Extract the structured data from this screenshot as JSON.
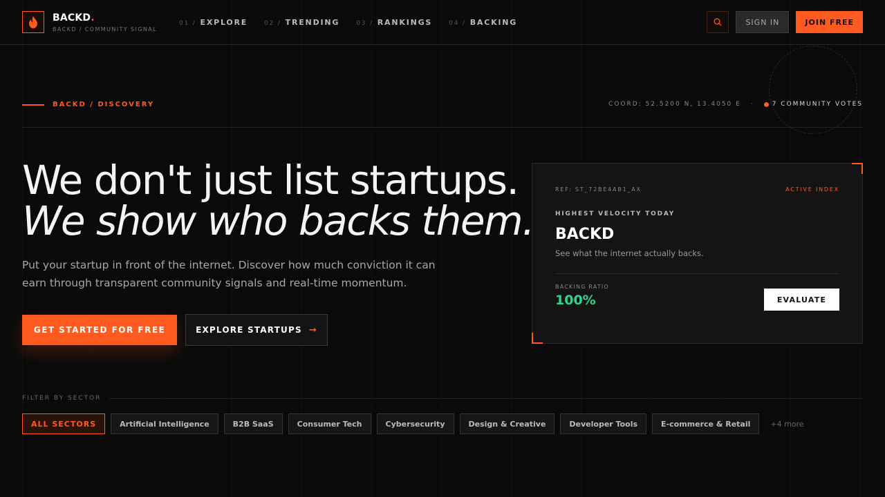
{
  "nav": {
    "brand": "BACKD",
    "brand_dot": ".",
    "brand_sub": "BACKD / COMMUNITY SIGNAL",
    "links": [
      {
        "num": "01 /",
        "label": "EXPLORE"
      },
      {
        "num": "02 /",
        "label": "TRENDING"
      },
      {
        "num": "03 /",
        "label": "RANKINGS"
      },
      {
        "num": "04 /",
        "label": "BACKING"
      }
    ],
    "signin": "SIGN IN",
    "join": "JOIN FREE"
  },
  "subhead": {
    "crumb": "BACKD / DISCOVERY",
    "coord": "COORD: 52.5200 N, 13.4050 E",
    "sep": "·",
    "votes": "7 COMMUNITY VOTES"
  },
  "hero": {
    "line1": "We don't just list startups.",
    "line2": "We show who backs them.",
    "description": "Put your startup in front of the internet. Discover how much conviction it can earn through transparent community signals and real-time momentum.",
    "cta_primary": "GET STARTED FOR FREE",
    "cta_secondary": "EXPLORE STARTUPS",
    "arrow": "→"
  },
  "card": {
    "ref": "REF: ST_72BE4AB1_AX",
    "status": "ACTIVE INDEX",
    "kicker": "HIGHEST VELOCITY TODAY",
    "title": "BACKD",
    "description": "See what the internet actually backs.",
    "ratio_label": "BACKING RATIO",
    "ratio_value": "100%",
    "evaluate": "EVALUATE"
  },
  "filter": {
    "label": "FILTER BY SECTOR",
    "chips": [
      "ALL SECTORS",
      "Artificial Intelligence",
      "B2B SaaS",
      "Consumer Tech",
      "Cybersecurity",
      "Design & Creative",
      "Developer Tools",
      "E-commerce & Retail"
    ],
    "more": "+4 more"
  },
  "colors": {
    "accent": "#ff5a1f",
    "positive": "#2dd68f",
    "background": "#0a0a0a"
  },
  "icons": [
    "flame-icon",
    "search-icon",
    "arrow-right-icon"
  ]
}
